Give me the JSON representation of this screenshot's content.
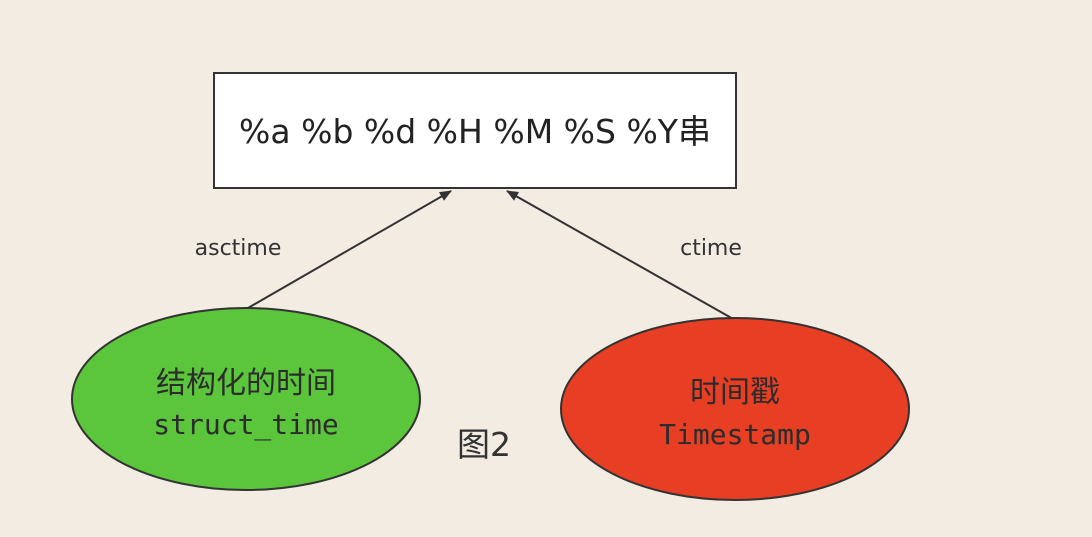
{
  "diagram": {
    "top_box": {
      "text": "%a %b %d %H %M %S %Y串"
    },
    "left_node": {
      "line1": "结构化的时间",
      "line2": "struct_time",
      "fill": "#5bc53c"
    },
    "right_node": {
      "line1": "时间戳",
      "line2": "Timestamp",
      "fill": "#e73e24"
    },
    "edges": {
      "left_label": "asctime",
      "right_label": "ctime"
    },
    "caption": "图2",
    "colors": {
      "background": "#f3ece2",
      "stroke": "#333333",
      "box_fill": "#ffffff"
    }
  }
}
